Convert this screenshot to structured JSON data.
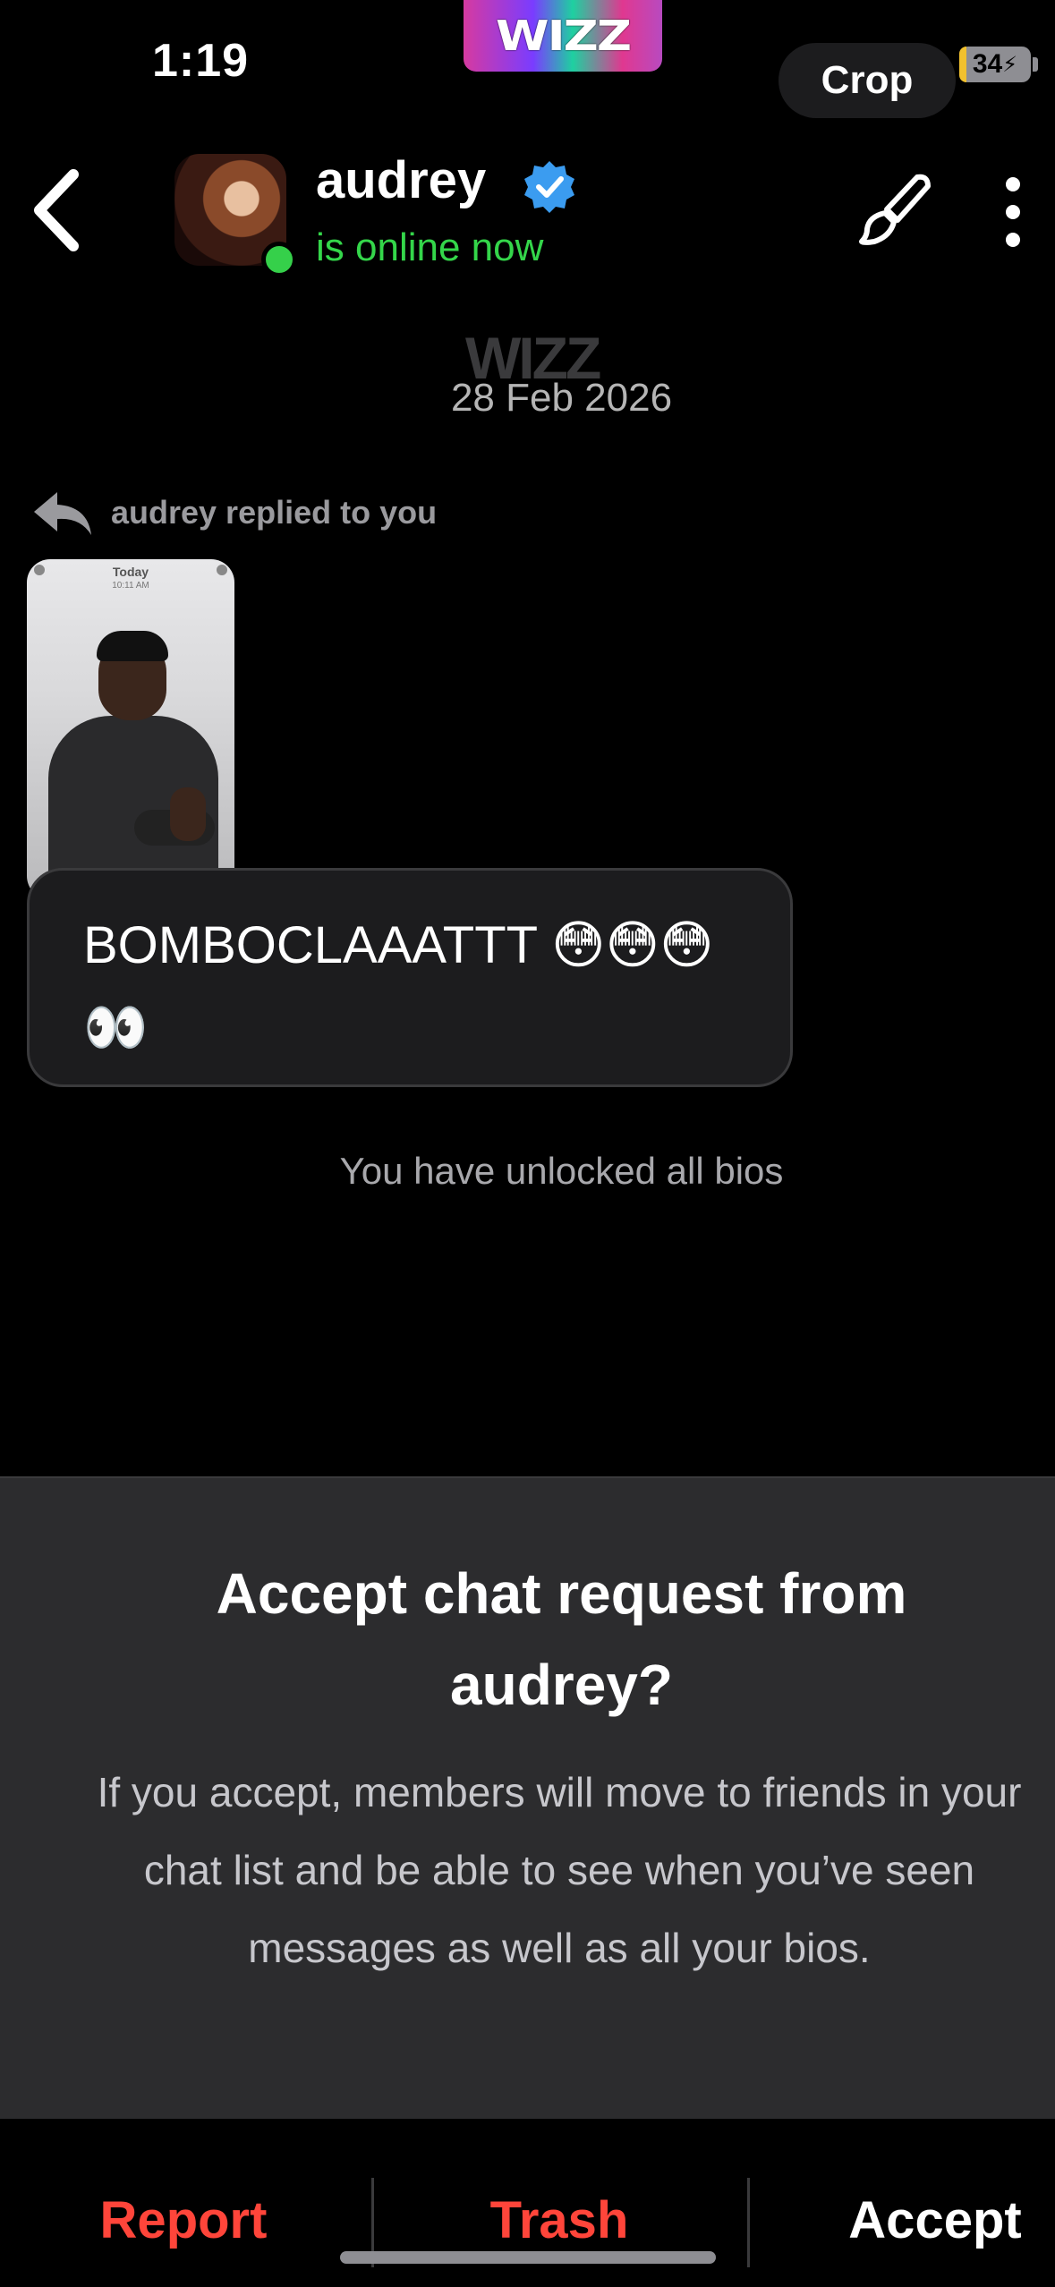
{
  "status_bar": {
    "time": "1:19",
    "logo": "WIZZ",
    "crop_label": "Crop",
    "battery": "34"
  },
  "header": {
    "username": "audrey",
    "online_status": "is online now",
    "icons": [
      "back-chevron-icon",
      "verified-badge-icon",
      "paint-brush-icon",
      "more-vertical-icon"
    ]
  },
  "chat": {
    "watermark": "WIZZ",
    "date": "28 Feb 2026",
    "reply_label": "audrey replied to you",
    "story_today": "Today",
    "story_time": "10:11 AM",
    "message": "BOMBOCLAAATTT 😳😳😳👀",
    "system_message": "You have unlocked all bios"
  },
  "sheet": {
    "title": "Accept chat request from audrey?",
    "body": "If you accept, members will move to friends in your chat list and be able to see when you’ve seen messages as well as all your bios."
  },
  "actions": {
    "report": "Report",
    "trash": "Trash",
    "accept": "Accept"
  },
  "colors": {
    "online_green": "#34d64a",
    "danger_red": "#ff453a",
    "verified_blue": "#3b9cf0",
    "sheet_bg": "#2c2c2e"
  }
}
